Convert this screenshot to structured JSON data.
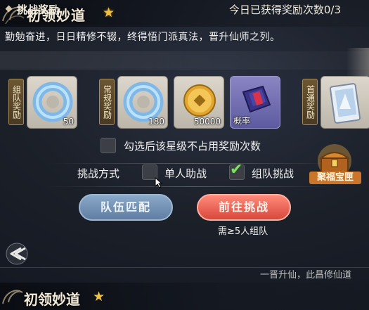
{
  "header": {
    "title": "初领妙道",
    "star_icon": "star-icon"
  },
  "description": "勤勉奋进，日日精修不辍，终得悟门派真法，晋升仙师之列。",
  "rewards_section": {
    "label": "挑战奖励",
    "count_text": "今日已获得奖励次数0/3"
  },
  "reward_groups": [
    {
      "tag": "组队奖励"
    },
    {
      "tag": "常规奖励"
    },
    {
      "tag": "首通奖励"
    }
  ],
  "reward_items": [
    {
      "icon": "jade-ring-icon",
      "qty": "50"
    },
    {
      "icon": "jade-ring-icon",
      "qty": "180"
    },
    {
      "icon": "gold-coin-icon",
      "qty": "50000"
    },
    {
      "icon": "scroll-bag-icon",
      "qty": "概率"
    },
    {
      "icon": "card-pack-icon",
      "qty": ""
    }
  ],
  "option": {
    "label": "勾选后该星级不占用奖励次数",
    "checked": false
  },
  "mode": {
    "label": "挑战方式",
    "options": [
      {
        "label": "单人助战",
        "checked": false
      },
      {
        "label": "组队挑战",
        "checked": true
      }
    ]
  },
  "buttons": {
    "match": "队伍匹配",
    "go": "前往挑战",
    "note": "需≥5人组队"
  },
  "chest": {
    "label": "聚福宝匣"
  },
  "bottom": {
    "title": "初领妙道",
    "snippet": "一晋升仙，此昌修仙道"
  },
  "colors": {
    "accent_gold": "#f2c23c",
    "match_blue": "#6f8fb4",
    "go_red": "#e25a4a",
    "check_green": "#7fe066"
  }
}
